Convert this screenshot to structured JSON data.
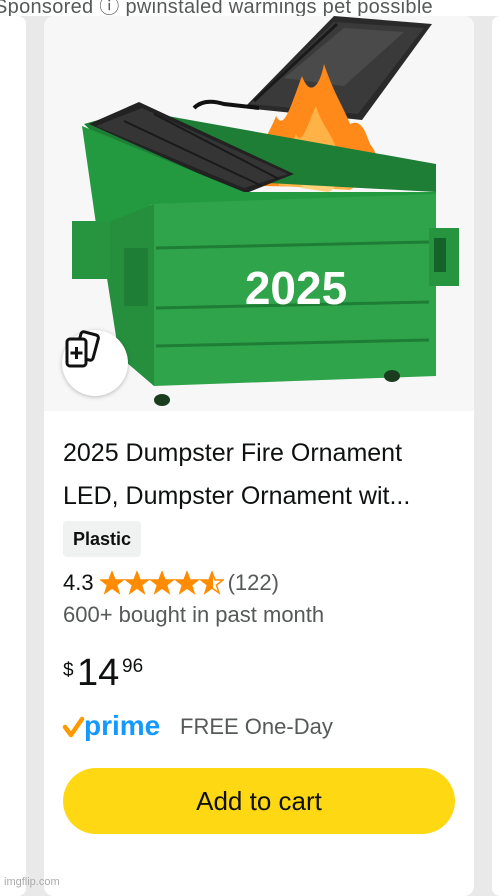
{
  "header": {
    "cut_text": "Sponsored ⓘ pwinstaled warmings pet possible"
  },
  "product": {
    "title": "2025 Dumpster Fire Ornament LED, Dumpster Ornament wit...",
    "badge": "Plastic",
    "rating_value": "4.3",
    "rating_stars": 4.3,
    "rating_count": "(122)",
    "bought": "600+ bought in past month",
    "price": {
      "symbol": "$",
      "whole": "14",
      "fraction": "96"
    },
    "prime_logo_text": "prime",
    "delivery": "FREE One-Day",
    "add_to_cart": "Add to cart",
    "image_year_text": "2025",
    "image_icon": "flip-cards-plus-icon"
  },
  "colors": {
    "cart_button": "#ffd814",
    "stars": "#ff8c00",
    "prime_blue": "#1399ff",
    "prime_check": "#ff9900",
    "dumpster_green": "#2fa44a"
  },
  "watermark": "imgflip.com"
}
